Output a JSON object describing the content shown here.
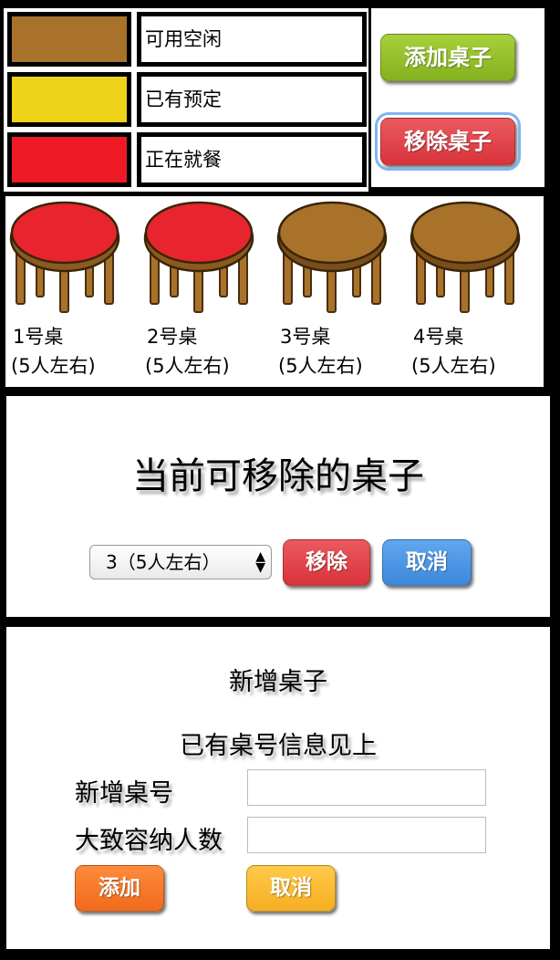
{
  "legend": {
    "items": [
      {
        "label": "可用空闲",
        "color": "#a8722b"
      },
      {
        "label": "已有预定",
        "color": "#eed318"
      },
      {
        "label": "正在就餐",
        "color": "#ee1a26"
      }
    ]
  },
  "toolbar": {
    "add_table_label": "添加桌子",
    "remove_table_label": "移除桌子"
  },
  "tables": [
    {
      "name": "1号桌",
      "capacity": "(5人左右)",
      "status": "dining",
      "top_color": "#e8252f"
    },
    {
      "name": "2号桌",
      "capacity": "(5人左右)",
      "status": "dining",
      "top_color": "#e8252f"
    },
    {
      "name": "3号桌",
      "capacity": "(5人左右)",
      "status": "available",
      "top_color": "#a8722b"
    },
    {
      "name": "4号桌",
      "capacity": "(5人左右)",
      "status": "available",
      "top_color": "#a8722b"
    }
  ],
  "remove_dialog": {
    "title": "当前可移除的桌子",
    "selected_option": "3（5人左右）",
    "remove_label": "移除",
    "cancel_label": "取消"
  },
  "add_form": {
    "title": "新增桌子",
    "subtitle": "已有桌号信息见上",
    "number_label": "新增桌号",
    "capacity_label": "大致容纳人数",
    "number_value": "",
    "capacity_value": "",
    "add_label": "添加",
    "cancel_label": "取消"
  },
  "colors": {
    "add_button": "#95c22b",
    "remove_button": "#e0434a",
    "cancel_blue": "#4d94e4",
    "add_orange": "#f77a2a",
    "cancel_yellow": "#f9bb34"
  }
}
